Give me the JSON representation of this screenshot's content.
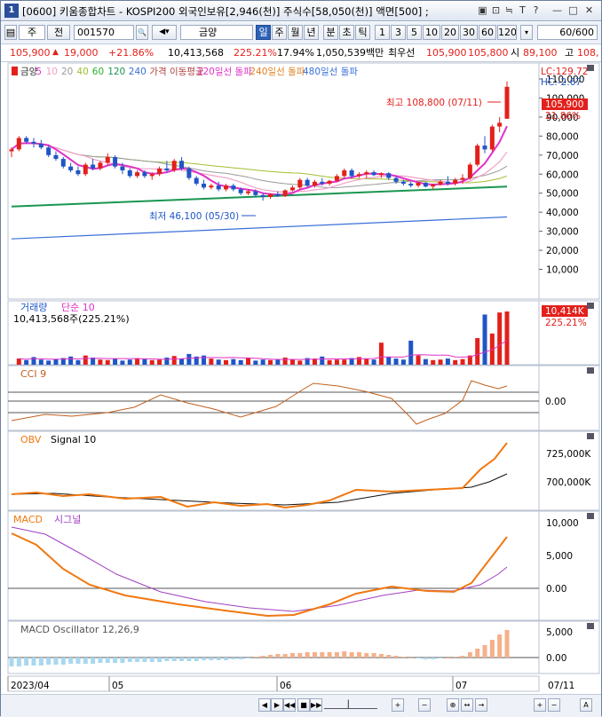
{
  "window": {
    "badge": "1",
    "title": "[0600] 키움종합차트 - KOSPI200 외국인보유[2,946(천)] 주식수[58,050(천)] 액면[500] ;",
    "controls": [
      "▣",
      "⊡",
      "≒",
      "T",
      "?",
      "—",
      "□",
      "✕"
    ]
  },
  "toolbar": {
    "market": "주",
    "market_kind": "전",
    "code": "001570",
    "stock_name": "금양",
    "periods": [
      "일",
      "주",
      "월",
      "년",
      "분",
      "초",
      "틱"
    ],
    "active_period": "일",
    "intervals": [
      "1",
      "3",
      "5",
      "10",
      "20",
      "30",
      "60",
      "120"
    ],
    "count": "60/600"
  },
  "infobar": {
    "price": "105,900",
    "change": "19,000",
    "change_pct": "+21.86%",
    "volume": "10,413,568",
    "vol_ratio": "225.21%",
    "turnover": "17.94%",
    "amount": "1,050,539백만",
    "best_label": "최우선",
    "best_ask": "105,900",
    "best_bid": "105,800",
    "open_label": "시",
    "open": "89,100",
    "high_label": "고",
    "high": "108,"
  },
  "colors": {
    "up": "#e3201b",
    "down": "#1f55c6",
    "ma5": "#e031c8",
    "ma10": "#f0a0c8",
    "ma20": "#9a9a9a",
    "ma40": "#a0c030",
    "ma60": "#2bb02b",
    "ma120": "#1a9650",
    "ma240": "#3a6fd8",
    "orange": "#f07810",
    "purple": "#a040c0"
  },
  "chart_data": [
    {
      "type": "candlestick",
      "title": "금양",
      "legend": [
        "금양",
        "5",
        "10",
        "20",
        "40",
        "60",
        "120",
        "240",
        "가격 이동평균",
        "120일선 돌파",
        "240일선 돌파",
        "480일선 돌파"
      ],
      "y_ticks": [
        "110,000",
        "100,000",
        "90,000",
        "80,000",
        "70,000",
        "60,000",
        "50,000",
        "40,000",
        "30,000",
        "20,000",
        "10,000"
      ],
      "ylim": [
        0,
        115000
      ],
      "dates": [
        "2023/04",
        "05",
        "06",
        "07",
        "07/11"
      ],
      "ohlc": [
        [
          72000,
          74000,
          69000,
          73000
        ],
        [
          73000,
          80000,
          72000,
          79000
        ],
        [
          79000,
          80000,
          76000,
          77000
        ],
        [
          77000,
          79000,
          74000,
          76000
        ],
        [
          76000,
          78000,
          73000,
          74000
        ],
        [
          74000,
          75000,
          69000,
          70000
        ],
        [
          70000,
          72000,
          67000,
          68000
        ],
        [
          68000,
          69000,
          63000,
          64000
        ],
        [
          64000,
          66000,
          61000,
          62000
        ],
        [
          62000,
          64000,
          59000,
          60000
        ],
        [
          60000,
          66000,
          59000,
          65000
        ],
        [
          65000,
          68000,
          62000,
          63000
        ],
        [
          63000,
          67000,
          62000,
          66000
        ],
        [
          66000,
          71000,
          65000,
          69000
        ],
        [
          69000,
          70000,
          63000,
          64000
        ],
        [
          64000,
          66000,
          60000,
          62000
        ],
        [
          62000,
          63000,
          58000,
          59000
        ],
        [
          59000,
          62000,
          58000,
          61000
        ],
        [
          61000,
          62000,
          58000,
          59000
        ],
        [
          59000,
          61000,
          57000,
          60000
        ],
        [
          60000,
          64000,
          59000,
          63000
        ],
        [
          63000,
          67000,
          61000,
          62000
        ],
        [
          62000,
          68000,
          61000,
          67000
        ],
        [
          67000,
          69000,
          62000,
          63000
        ],
        [
          63000,
          64000,
          57000,
          58000
        ],
        [
          58000,
          59000,
          54000,
          55000
        ],
        [
          55000,
          57000,
          52000,
          53000
        ],
        [
          53000,
          55000,
          52000,
          54000
        ],
        [
          54000,
          56000,
          51000,
          52000
        ],
        [
          52000,
          55000,
          51000,
          54000
        ],
        [
          54000,
          55000,
          51000,
          52000
        ],
        [
          52000,
          53000,
          49000,
          50000
        ],
        [
          50000,
          52000,
          49000,
          51000
        ],
        [
          51000,
          52000,
          48000,
          49000
        ],
        [
          49000,
          50000,
          46100,
          48000
        ],
        [
          48000,
          50000,
          47000,
          49500
        ],
        [
          49500,
          51000,
          48000,
          48500
        ],
        [
          48500,
          52000,
          48000,
          51500
        ],
        [
          51500,
          54000,
          51000,
          53000
        ],
        [
          53000,
          58000,
          52000,
          57000
        ],
        [
          57000,
          58000,
          53000,
          54000
        ],
        [
          54000,
          57000,
          53000,
          56000
        ],
        [
          56000,
          58000,
          54000,
          55000
        ],
        [
          55000,
          57000,
          54000,
          56500
        ],
        [
          56500,
          60000,
          56000,
          59000
        ],
        [
          59000,
          63000,
          58000,
          62000
        ],
        [
          62000,
          63000,
          58000,
          59000
        ],
        [
          59000,
          61000,
          58000,
          60000
        ],
        [
          60000,
          62000,
          58000,
          61000
        ],
        [
          61000,
          62000,
          59000,
          59500
        ],
        [
          59500,
          61000,
          58000,
          60500
        ],
        [
          60500,
          61000,
          57000,
          58000
        ],
        [
          58000,
          59000,
          55000,
          56000
        ],
        [
          56000,
          57000,
          54000,
          55000
        ],
        [
          55000,
          56000,
          53000,
          54000
        ],
        [
          54000,
          56000,
          53000,
          55500
        ],
        [
          55500,
          56000,
          53000,
          53500
        ],
        [
          53500,
          55000,
          52000,
          54500
        ],
        [
          54500,
          57000,
          54000,
          56000
        ],
        [
          56000,
          59000,
          54000,
          55000
        ],
        [
          55000,
          58000,
          54000,
          57000
        ],
        [
          57000,
          60000,
          55000,
          58000
        ],
        [
          58000,
          66000,
          57000,
          65000
        ],
        [
          65000,
          76000,
          64000,
          75000
        ],
        [
          75000,
          80000,
          71000,
          73000
        ],
        [
          73000,
          86000,
          72000,
          85000
        ],
        [
          85000,
          90000,
          82000,
          87000
        ],
        [
          89100,
          108800,
          89100,
          105900
        ]
      ],
      "annotations": {
        "high": "최고 108,800 (07/11)",
        "low": "최저 46,100 (05/30)",
        "last_price": "105,900",
        "pct": "21.86%",
        "lc": "LC:129.72",
        "hc": "HC:-2.67"
      }
    },
    {
      "type": "bar",
      "title": "거래량",
      "legend": [
        "거래량",
        "단순 10"
      ],
      "info": "10,413,568주(225.21%)",
      "last_label": "10,414K",
      "last_pct": "225.21%",
      "values_k": [
        1200,
        900,
        1500,
        1000,
        800,
        1100,
        1300,
        1600,
        900,
        1800,
        1400,
        1000,
        900,
        1200,
        800,
        1000,
        1300,
        1100,
        900,
        1000,
        1400,
        1700,
        1200,
        2100,
        1600,
        1800,
        1200,
        1000,
        900,
        1100,
        900,
        1300,
        800,
        1000,
        900,
        1100,
        1400,
        1000,
        800,
        1300,
        1200,
        1600,
        900,
        1000,
        1000,
        1300,
        1500,
        1200,
        1000,
        4300,
        1500,
        1200,
        1000,
        4700,
        1800,
        1100,
        900,
        1000,
        1200,
        900,
        1100,
        1800,
        5200,
        9800,
        6100,
        10200,
        10400
      ]
    },
    {
      "type": "line",
      "title": "CCI",
      "legend": [
        "CCI 9"
      ],
      "y_ticks": [
        "0.00"
      ]
    },
    {
      "type": "line",
      "title": "OBV",
      "legend": [
        "OBV",
        "Signal 10"
      ],
      "y_ticks": [
        "725,000K",
        "700,000K"
      ]
    },
    {
      "type": "line",
      "title": "MACD",
      "legend": [
        "MACD",
        "시그널"
      ],
      "y_ticks": [
        "10,000",
        "5,000",
        "0.00"
      ]
    },
    {
      "type": "bar",
      "title": "MACD Oscillator",
      "legend": [
        "MACD Oscillator 12,26,9"
      ],
      "y_ticks": [
        "5,000",
        "0.00"
      ]
    }
  ],
  "nav": {
    "buttons": [
      "◀",
      "▶",
      "◀◀",
      "■",
      "▶▶",
      "▏",
      "+",
      "−",
      "⊕",
      "↔",
      "→",
      "+",
      "−",
      "A"
    ]
  }
}
